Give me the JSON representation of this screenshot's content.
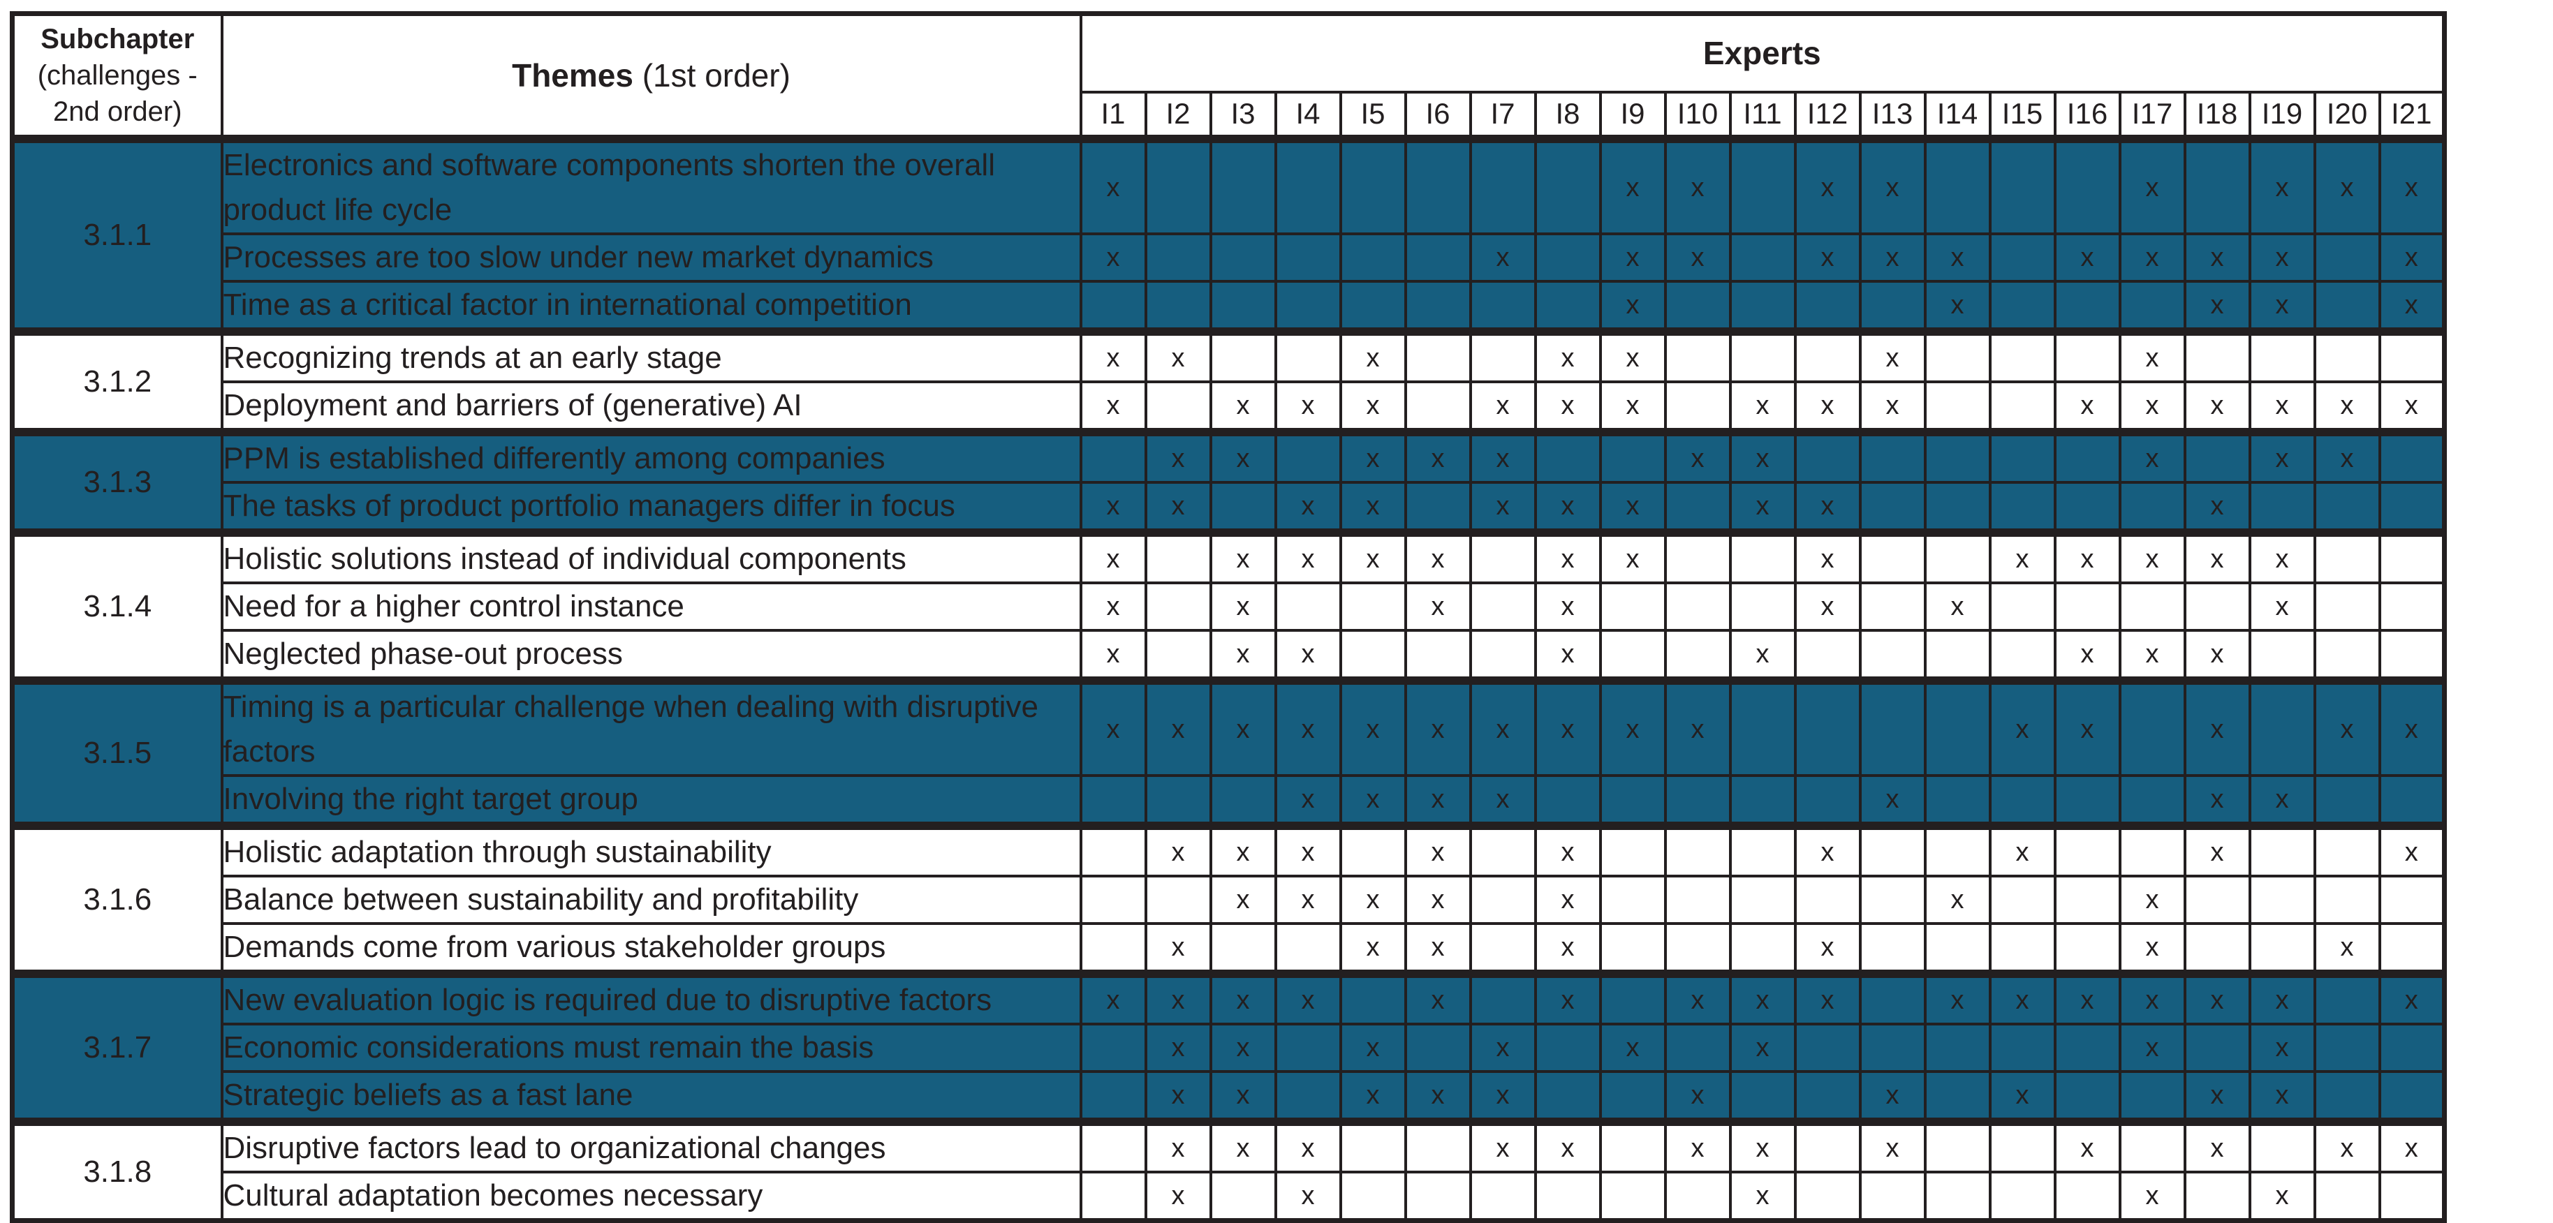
{
  "header": {
    "subchapter_bold": "Subchapter",
    "subchapter_rest": "(challenges - 2nd order)",
    "themes_bold": "Themes",
    "themes_rest": " (1st order)",
    "experts": "Experts",
    "expert_ids": [
      "I1",
      "I2",
      "I3",
      "I4",
      "I5",
      "I6",
      "I7",
      "I8",
      "I9",
      "I10",
      "I11",
      "I12",
      "I13",
      "I14",
      "I15",
      "I16",
      "I17",
      "I18",
      "I19",
      "I20",
      "I21"
    ]
  },
  "mark_symbol": "x",
  "colors": {
    "shaded_bg": "#165e7f",
    "border": "#231f20",
    "text_dark": "#231f20",
    "text_light": "#ffffff"
  },
  "groups": [
    {
      "id": "3.1.1",
      "shaded": true,
      "themes": [
        {
          "text": "Electronics and software components shorten the overall product life cycle",
          "tall": true,
          "marks": [
            1,
            0,
            0,
            0,
            0,
            0,
            0,
            0,
            1,
            1,
            0,
            1,
            1,
            0,
            0,
            0,
            1,
            0,
            1,
            1,
            1
          ]
        },
        {
          "text": "Processes are too slow under new market dynamics",
          "marks": [
            1,
            0,
            0,
            0,
            0,
            0,
            1,
            0,
            1,
            1,
            0,
            1,
            1,
            1,
            0,
            1,
            1,
            1,
            1,
            0,
            1
          ]
        },
        {
          "text": "Time as a critical factor in international competition",
          "marks": [
            0,
            0,
            0,
            0,
            0,
            0,
            0,
            0,
            1,
            0,
            0,
            0,
            0,
            1,
            0,
            0,
            0,
            1,
            1,
            0,
            1
          ]
        }
      ]
    },
    {
      "id": "3.1.2",
      "shaded": false,
      "themes": [
        {
          "text": "Recognizing trends at an early stage",
          "marks": [
            1,
            1,
            0,
            0,
            1,
            0,
            0,
            1,
            1,
            0,
            0,
            0,
            1,
            0,
            0,
            0,
            1,
            0,
            0,
            0,
            0
          ]
        },
        {
          "text": "Deployment and barriers of (generative) AI",
          "marks": [
            1,
            0,
            1,
            1,
            1,
            0,
            1,
            1,
            1,
            0,
            1,
            1,
            1,
            0,
            0,
            1,
            1,
            1,
            1,
            1,
            1
          ]
        }
      ]
    },
    {
      "id": "3.1.3",
      "shaded": true,
      "themes": [
        {
          "text": "PPM is established differently among companies",
          "marks": [
            0,
            1,
            1,
            0,
            1,
            1,
            1,
            0,
            0,
            1,
            1,
            0,
            0,
            0,
            0,
            0,
            1,
            0,
            1,
            1,
            0
          ]
        },
        {
          "text": "The tasks of product portfolio managers differ in focus",
          "marks": [
            1,
            1,
            0,
            1,
            1,
            0,
            1,
            1,
            1,
            0,
            1,
            1,
            0,
            0,
            0,
            0,
            0,
            1,
            0,
            0,
            0
          ]
        }
      ]
    },
    {
      "id": "3.1.4",
      "shaded": false,
      "themes": [
        {
          "text": "Holistic solutions instead of individual components",
          "marks": [
            1,
            0,
            1,
            1,
            1,
            1,
            0,
            1,
            1,
            0,
            0,
            1,
            0,
            0,
            1,
            1,
            1,
            1,
            1,
            0,
            0
          ]
        },
        {
          "text": "Need for a higher control instance",
          "marks": [
            1,
            0,
            1,
            0,
            0,
            1,
            0,
            1,
            0,
            0,
            0,
            1,
            0,
            1,
            0,
            0,
            0,
            0,
            1,
            0,
            0
          ]
        },
        {
          "text": "Neglected phase-out process",
          "marks": [
            1,
            0,
            1,
            1,
            0,
            0,
            0,
            1,
            0,
            0,
            1,
            0,
            0,
            0,
            0,
            1,
            1,
            1,
            0,
            0,
            0
          ]
        }
      ]
    },
    {
      "id": "3.1.5",
      "shaded": true,
      "themes": [
        {
          "text": "Timing is a particular challenge when dealing with disruptive factors",
          "tall": true,
          "marks": [
            1,
            1,
            1,
            1,
            1,
            1,
            1,
            1,
            1,
            1,
            0,
            0,
            0,
            0,
            1,
            1,
            0,
            1,
            0,
            1,
            1
          ]
        },
        {
          "text": "Involving the right target group",
          "marks": [
            0,
            0,
            0,
            1,
            1,
            1,
            1,
            0,
            0,
            0,
            0,
            0,
            1,
            0,
            0,
            0,
            0,
            1,
            1,
            0,
            0
          ]
        }
      ]
    },
    {
      "id": "3.1.6",
      "shaded": false,
      "themes": [
        {
          "text": "Holistic adaptation through sustainability",
          "marks": [
            0,
            1,
            1,
            1,
            0,
            1,
            0,
            1,
            0,
            0,
            0,
            1,
            0,
            0,
            1,
            0,
            0,
            1,
            0,
            0,
            1
          ]
        },
        {
          "text": "Balance between sustainability and profitability",
          "marks": [
            0,
            0,
            1,
            1,
            1,
            1,
            0,
            1,
            0,
            0,
            0,
            0,
            0,
            1,
            0,
            0,
            1,
            0,
            0,
            0,
            0
          ]
        },
        {
          "text": "Demands come from various stakeholder groups",
          "marks": [
            0,
            1,
            0,
            0,
            1,
            1,
            0,
            1,
            0,
            0,
            0,
            1,
            0,
            0,
            0,
            0,
            1,
            0,
            0,
            1,
            0
          ]
        }
      ]
    },
    {
      "id": "3.1.7",
      "shaded": true,
      "themes": [
        {
          "text": "New evaluation logic is required due to disruptive factors",
          "marks": [
            1,
            1,
            1,
            1,
            0,
            1,
            0,
            1,
            0,
            1,
            1,
            1,
            0,
            1,
            1,
            1,
            1,
            1,
            1,
            0,
            1
          ]
        },
        {
          "text": "Economic considerations must remain the basis",
          "marks": [
            0,
            1,
            1,
            0,
            1,
            0,
            1,
            0,
            1,
            0,
            1,
            0,
            0,
            0,
            0,
            0,
            1,
            0,
            1,
            0,
            0
          ]
        },
        {
          "text": "Strategic beliefs as a fast lane",
          "marks": [
            0,
            1,
            1,
            0,
            1,
            1,
            1,
            0,
            0,
            1,
            0,
            0,
            1,
            0,
            1,
            0,
            0,
            1,
            1,
            0,
            0
          ]
        }
      ]
    },
    {
      "id": "3.1.8",
      "shaded": false,
      "themes": [
        {
          "text": "Disruptive factors lead to organizational changes",
          "marks": [
            0,
            1,
            1,
            1,
            0,
            0,
            1,
            1,
            0,
            1,
            1,
            0,
            1,
            0,
            0,
            1,
            0,
            1,
            0,
            1,
            1
          ]
        },
        {
          "text": "Cultural adaptation becomes necessary",
          "marks": [
            0,
            1,
            0,
            1,
            0,
            0,
            0,
            0,
            0,
            0,
            1,
            0,
            0,
            0,
            0,
            0,
            1,
            0,
            1,
            0,
            0
          ]
        }
      ]
    }
  ]
}
